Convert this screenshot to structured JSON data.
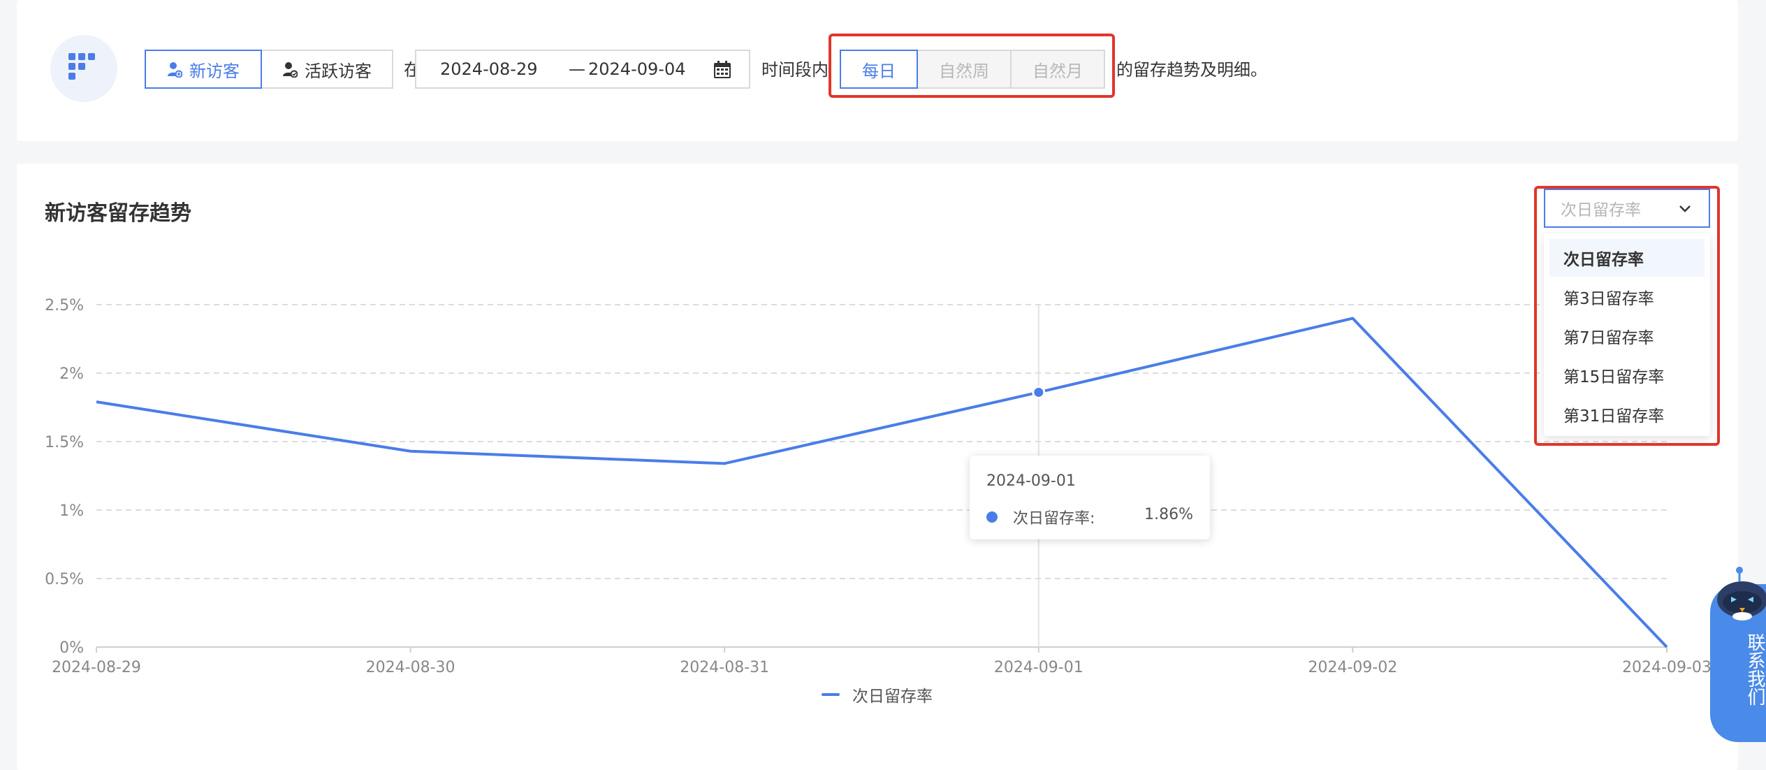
{
  "filters": {
    "visitor_types": [
      {
        "label": "新访客",
        "active": true
      },
      {
        "label": "活跃访客",
        "active": false
      }
    ],
    "prefix": "在",
    "date_start": "2024-08-29",
    "date_separator": "—",
    "date_end": "2024-09-04",
    "period_text": "时间段内",
    "granularity": [
      {
        "label": "每日",
        "active": true
      },
      {
        "label": "自然周",
        "active": false
      },
      {
        "label": "自然月",
        "active": false
      }
    ],
    "suffix": "的留存趋势及明细。"
  },
  "panel": {
    "title": "新访客留存趋势",
    "metric_select": {
      "value": "次日留存率",
      "options": [
        "次日留存率",
        "第3日留存率",
        "第7日留存率",
        "第15日留存率",
        "第31日留存率"
      ],
      "selected_index": 0
    }
  },
  "chart_data": {
    "type": "line",
    "x": [
      "2024-08-29",
      "2024-08-30",
      "2024-08-31",
      "2024-09-01",
      "2024-09-02",
      "2024-09-03"
    ],
    "series": [
      {
        "name": "次日留存率",
        "values": [
          1.79,
          1.43,
          1.34,
          1.86,
          2.4,
          0
        ]
      }
    ],
    "y_ticks": [
      "0%",
      "0.5%",
      "1%",
      "1.5%",
      "2%",
      "2.5%"
    ],
    "ylim": [
      0,
      2.5
    ],
    "grid": true,
    "legend": "bottom-center",
    "color": "#4a7de8",
    "tooltip": {
      "date": "2024-09-01",
      "label": "次日留存率:",
      "value": "1.86%"
    }
  },
  "contact": {
    "label": "联系我们"
  },
  "colors": {
    "accent": "#4a7de8",
    "highlight": "#e0362c"
  }
}
